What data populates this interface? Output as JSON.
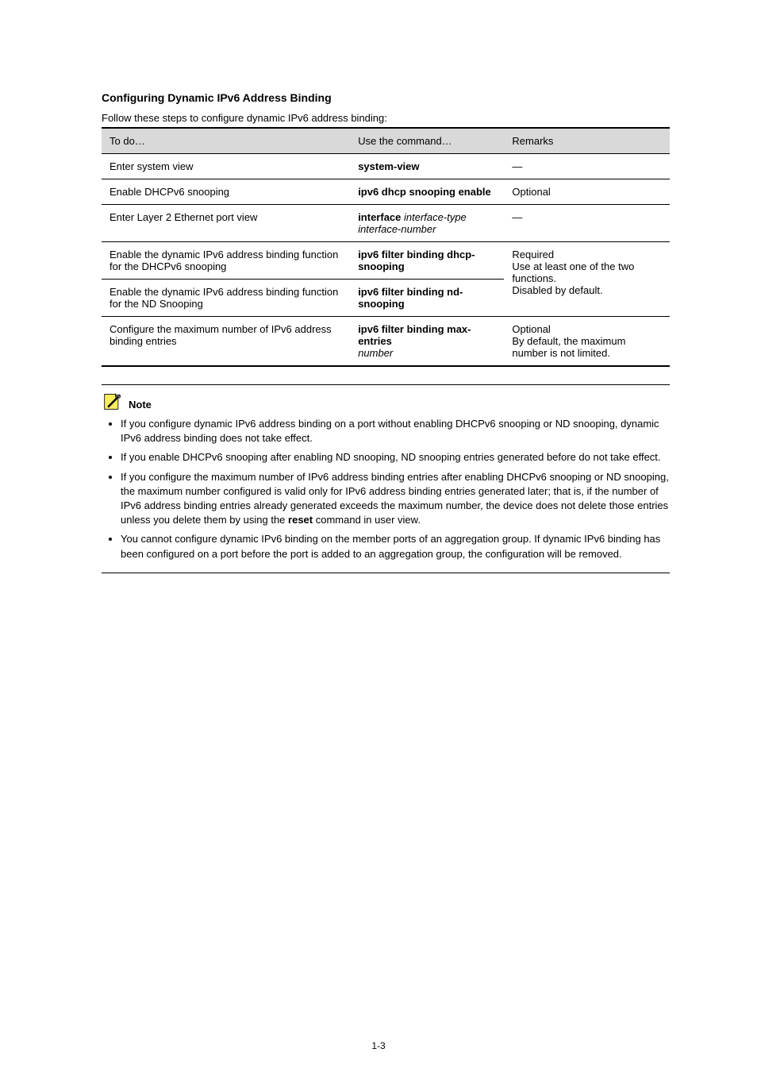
{
  "section_title": "Configuring Dynamic IPv6 Address Binding",
  "table_caption": "Follow these steps to configure dynamic IPv6 address binding:",
  "table": {
    "headers": [
      "To do…",
      "Use the command…",
      "Remarks"
    ],
    "rows": [
      {
        "to_do": "Enter system view",
        "cmd_bold": "system-view",
        "cmd_ital": "",
        "remarks": "—"
      },
      {
        "to_do": "Enable DHCPv6 snooping",
        "cmd_bold": "ipv6 dhcp snooping enable",
        "cmd_ital": "",
        "remarks": "Optional"
      },
      {
        "to_do": "Enter Layer 2 Ethernet port view",
        "cmd_line1_bold": "interface",
        "cmd_line1_ital": "interface-type interface-number",
        "remarks": "—"
      },
      {
        "to_do": "Enable the dynamic IPv6 address binding function for the DHCPv6 snooping",
        "cmd_bold": "ipv6 filter binding dhcp-snooping",
        "cmd_ital": "",
        "remarks_rowspan": "Required\nUse at least one of the two functions.\nDisabled by default."
      },
      {
        "to_do": "Enable the dynamic IPv6 address binding function for the ND Snooping",
        "cmd_bold": "ipv6 filter binding nd-snooping",
        "cmd_ital": "",
        "remarks": ""
      },
      {
        "to_do": "Configure the maximum number of IPv6 address binding entries",
        "cmd_line1_bold": "ipv6 filter binding max-entries",
        "cmd_line1_ital": "number",
        "remarks": "Optional\nBy default, the maximum number is not limited."
      }
    ]
  },
  "note_label": "Note",
  "notes": [
    "If you configure dynamic IPv6 address binding on a port without enabling DHCPv6 snooping or ND snooping, dynamic IPv6 address binding does not take effect.",
    "If you enable DHCPv6 snooping after enabling ND snooping, ND snooping entries generated before do not take effect.",
    {
      "pre": "If you configure the maximum number of IPv6 address binding entries after enabling DHCPv6 snooping or ND snooping, the maximum number configured is valid only for IPv6 address binding entries generated later; that is, if the number of IPv6 address binding entries already generated exceeds the maximum number, the device does not delete those entries unless you delete them by using the ",
      "bold_cmd": "reset",
      "post": " command in user view."
    },
    "You cannot configure dynamic IPv6 binding on the member ports of an aggregation group. If dynamic IPv6 binding has been configured on a port before the port is added to an aggregation group, the configuration will be removed."
  ],
  "page_number": "1-3"
}
